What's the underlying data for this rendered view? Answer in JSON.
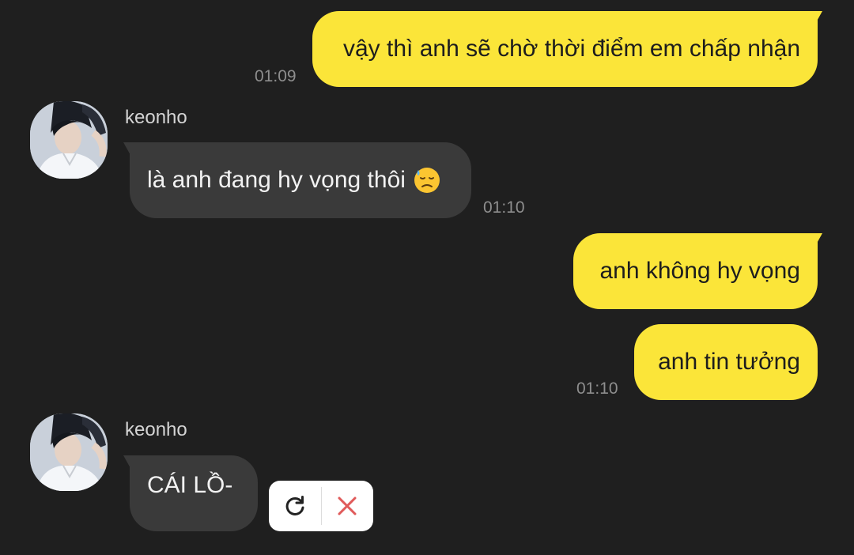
{
  "messages": {
    "m1": {
      "text": "vậy thì anh sẽ chờ thời điểm em chấp nhận",
      "time": "01:09"
    },
    "m2": {
      "sender": "keonho",
      "text": "là anh đang hy vọng thôi",
      "emoji": "downcast-face-with-sweat-icon",
      "time": "01:10"
    },
    "m3": {
      "text": "anh không hy vọng"
    },
    "m4": {
      "text": "anh tin tưởng",
      "time": "01:10"
    },
    "m5": {
      "sender": "keonho",
      "text": "CÁI LỒ-"
    }
  },
  "failed_actions": {
    "retry_icon": "retry-icon",
    "delete_icon": "close-icon"
  },
  "colors": {
    "background": "#1f1f1f",
    "outgoing_bubble": "#fbe539",
    "incoming_bubble": "#3a3a3a",
    "timestamp": "#8e8e8e",
    "delete_red": "#e05a5a"
  }
}
